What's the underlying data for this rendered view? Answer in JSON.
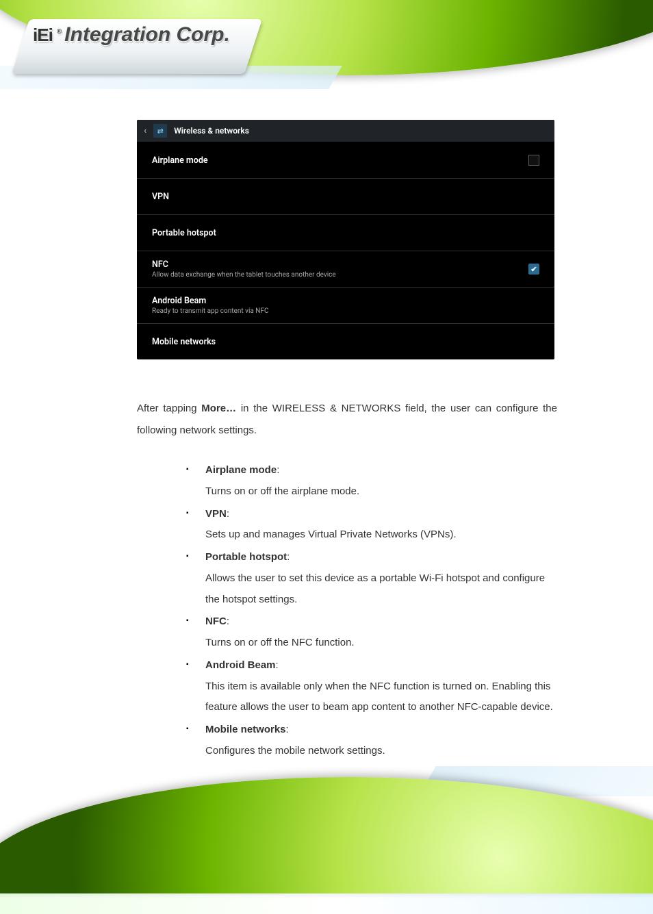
{
  "logo": {
    "brand_prefix": "iEi",
    "reg": "®",
    "brand": "Integration Corp."
  },
  "android": {
    "title": "Wireless & networks",
    "rows": [
      {
        "label": "Airplane mode",
        "sub": "",
        "control": "checkbox"
      },
      {
        "label": "VPN",
        "sub": "",
        "control": "none"
      },
      {
        "label": "Portable hotspot",
        "sub": "",
        "control": "none"
      },
      {
        "label": "NFC",
        "sub": "Allow data exchange when the tablet touches another device",
        "control": "checked"
      },
      {
        "label": "Android Beam",
        "sub": "Ready to transmit app content via NFC",
        "control": "none"
      },
      {
        "label": "Mobile networks",
        "sub": "",
        "control": "none"
      }
    ]
  },
  "para": {
    "pre": "After tapping ",
    "bold": "More…",
    "post": " in the WIRELESS & NETWORKS field, the user can configure the following network settings."
  },
  "items": [
    {
      "title": "Airplane mode",
      "desc": "Turns on or off the airplane mode."
    },
    {
      "title": "VPN",
      "desc": "Sets up and manages Virtual Private Networks (VPNs)."
    },
    {
      "title": "Portable hotspot",
      "desc": "Allows the user to set this device as a portable Wi-Fi hotspot and configure the hotspot settings."
    },
    {
      "title": "NFC",
      "desc": "Turns on or off the NFC function."
    },
    {
      "title": "Android Beam",
      "desc": "This item is available only when the NFC function is turned on. Enabling this feature allows the user to beam app content to another NFC-capable device."
    },
    {
      "title": "Mobile networks",
      "desc": "Configures the mobile network settings."
    }
  ],
  "sep": ":"
}
